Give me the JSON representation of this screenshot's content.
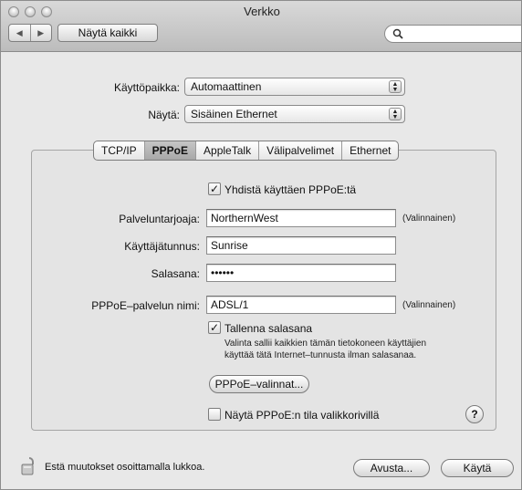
{
  "window": {
    "title": "Verkko"
  },
  "toolbar": {
    "back": "◀",
    "forward": "▶",
    "show_all": "Näytä kaikki",
    "search_placeholder": ""
  },
  "location": {
    "label": "Käyttöpaikka:",
    "value": "Automaattinen"
  },
  "show": {
    "label": "Näytä:",
    "value": "Sisäinen Ethernet"
  },
  "tabs": [
    "TCP/IP",
    "PPPoE",
    "AppleTalk",
    "Välipalvelimet",
    "Ethernet"
  ],
  "pppoe": {
    "connect_checkbox": {
      "label": "Yhdistä käyttäen PPPoE:tä",
      "checked": true
    },
    "provider": {
      "label": "Palveluntarjoaja:",
      "value": "NorthernWest",
      "optional": "(Valinnainen)"
    },
    "account": {
      "label": "Käyttäjätunnus:",
      "value": "Sunrise"
    },
    "password": {
      "label": "Salasana:",
      "value": "••••••"
    },
    "service": {
      "label": "PPPoE–palvelun nimi:",
      "value": "ADSL/1",
      "optional": "(Valinnainen)"
    },
    "save_password": {
      "label": "Tallenna salasana",
      "checked": true,
      "note_line1": "Valinta sallii kaikkien tämän tietokoneen käyttäjien",
      "note_line2": "käyttää tätä Internet–tunnusta ilman salasanaa."
    },
    "options_button": "PPPoE–valinnat...",
    "show_status": {
      "label": "Näytä PPPoE:n tila valikkorivillä",
      "checked": false
    },
    "help": "?"
  },
  "footer": {
    "lock_text": "Estä muutokset osoittamalla lukkoa.",
    "assist_button": "Avusta...",
    "apply_button": "Käytä"
  }
}
